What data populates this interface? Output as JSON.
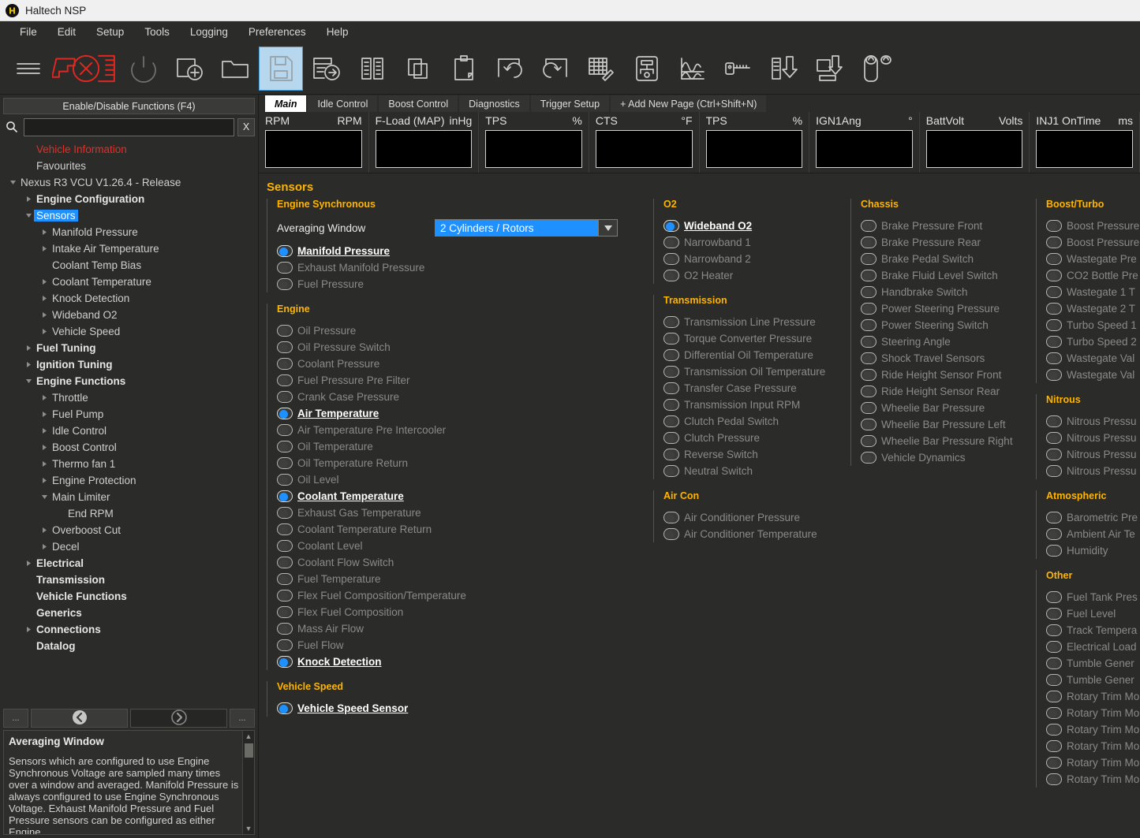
{
  "window": {
    "title": "Haltech NSP",
    "logo_icon": "haltech-logo-icon"
  },
  "menubar": {
    "items": [
      "File",
      "Edit",
      "Setup",
      "Tools",
      "Logging",
      "Preferences",
      "Help"
    ]
  },
  "toolbar": {
    "items": [
      {
        "name": "hamburger-menu-icon",
        "label": "Menu",
        "state": "normal"
      },
      {
        "name": "disconnect-ecu-icon",
        "label": "Disconnect ECU",
        "state": "normal"
      },
      {
        "name": "power-icon",
        "label": "Power",
        "state": "disabled"
      },
      {
        "name": "new-file-icon",
        "label": "New",
        "state": "normal"
      },
      {
        "name": "open-folder-icon",
        "label": "Open",
        "state": "normal"
      },
      {
        "name": "save-icon",
        "label": "Save",
        "state": "selected"
      },
      {
        "name": "save-as-icon",
        "label": "Save As",
        "state": "normal"
      },
      {
        "name": "compare-icon",
        "label": "Compare",
        "state": "normal"
      },
      {
        "name": "copy-icon",
        "label": "Copy",
        "state": "normal"
      },
      {
        "name": "paste-icon",
        "label": "Paste",
        "state": "normal"
      },
      {
        "name": "undo-icon",
        "label": "Undo",
        "state": "normal"
      },
      {
        "name": "redo-icon",
        "label": "Redo",
        "state": "normal"
      },
      {
        "name": "table-edit-icon",
        "label": "Edit Table",
        "state": "normal"
      },
      {
        "name": "wiring-diagram-icon",
        "label": "Wiring",
        "state": "normal"
      },
      {
        "name": "scope-icon",
        "label": "Scope",
        "state": "normal"
      },
      {
        "name": "key-license-icon",
        "label": "License",
        "state": "normal"
      },
      {
        "name": "download-to-ecu-icon",
        "label": "Send to ECU",
        "state": "normal"
      },
      {
        "name": "upload-from-ecu-icon",
        "label": "Get from ECU",
        "state": "normal"
      },
      {
        "name": "fuel-tune-icon",
        "label": "Tune",
        "state": "normal"
      }
    ]
  },
  "sidebar": {
    "functions_button": "Enable/Disable Functions (F4)",
    "search": {
      "value": "",
      "placeholder": "",
      "clear_label": "X",
      "icon": "search-icon"
    },
    "tree": [
      {
        "label": "Vehicle Information",
        "indent": 1,
        "arrow": "none",
        "style": "red"
      },
      {
        "label": "Favourites",
        "indent": 1,
        "arrow": "none",
        "style": "normal"
      },
      {
        "label": "Nexus R3 VCU V1.26.4 - Release",
        "indent": 0,
        "arrow": "down",
        "style": "normal"
      },
      {
        "label": "Engine Configuration",
        "indent": 1,
        "arrow": "right",
        "style": "bold"
      },
      {
        "label": "Sensors",
        "indent": 1,
        "arrow": "down",
        "style": "selected"
      },
      {
        "label": "Manifold Pressure",
        "indent": 2,
        "arrow": "right",
        "style": "normal"
      },
      {
        "label": "Intake Air Temperature",
        "indent": 2,
        "arrow": "right",
        "style": "normal"
      },
      {
        "label": "Coolant Temp Bias",
        "indent": 2,
        "arrow": "none",
        "style": "normal"
      },
      {
        "label": "Coolant Temperature",
        "indent": 2,
        "arrow": "right",
        "style": "normal"
      },
      {
        "label": "Knock Detection",
        "indent": 2,
        "arrow": "right",
        "style": "normal"
      },
      {
        "label": "Wideband O2",
        "indent": 2,
        "arrow": "right",
        "style": "normal"
      },
      {
        "label": "Vehicle Speed",
        "indent": 2,
        "arrow": "right",
        "style": "normal"
      },
      {
        "label": "Fuel Tuning",
        "indent": 1,
        "arrow": "right",
        "style": "bold"
      },
      {
        "label": "Ignition Tuning",
        "indent": 1,
        "arrow": "right",
        "style": "bold"
      },
      {
        "label": "Engine Functions",
        "indent": 1,
        "arrow": "down",
        "style": "bold"
      },
      {
        "label": "Throttle",
        "indent": 2,
        "arrow": "right",
        "style": "normal"
      },
      {
        "label": "Fuel Pump",
        "indent": 2,
        "arrow": "right",
        "style": "normal"
      },
      {
        "label": "Idle Control",
        "indent": 2,
        "arrow": "right",
        "style": "normal"
      },
      {
        "label": "Boost Control",
        "indent": 2,
        "arrow": "right",
        "style": "normal"
      },
      {
        "label": "Thermo fan 1",
        "indent": 2,
        "arrow": "right",
        "style": "normal"
      },
      {
        "label": "Engine Protection",
        "indent": 2,
        "arrow": "right",
        "style": "normal"
      },
      {
        "label": "Main Limiter",
        "indent": 2,
        "arrow": "down",
        "style": "normal"
      },
      {
        "label": "End RPM",
        "indent": 3,
        "arrow": "none",
        "style": "normal"
      },
      {
        "label": "Overboost Cut",
        "indent": 2,
        "arrow": "right",
        "style": "normal"
      },
      {
        "label": "Decel",
        "indent": 2,
        "arrow": "right",
        "style": "normal"
      },
      {
        "label": "Electrical",
        "indent": 1,
        "arrow": "right",
        "style": "bold"
      },
      {
        "label": "Transmission",
        "indent": 1,
        "arrow": "none",
        "style": "bold"
      },
      {
        "label": "Vehicle Functions",
        "indent": 1,
        "arrow": "none",
        "style": "bold"
      },
      {
        "label": "Generics",
        "indent": 1,
        "arrow": "none",
        "style": "bold"
      },
      {
        "label": "Connections",
        "indent": 1,
        "arrow": "right",
        "style": "bold"
      },
      {
        "label": "Datalog",
        "indent": 1,
        "arrow": "none",
        "style": "bold"
      }
    ],
    "nav": {
      "more_left_label": "...",
      "back_icon": "chevron-left-circle-icon",
      "forward_icon": "chevron-right-circle-icon",
      "more_right_label": "..."
    },
    "help": {
      "title": "Averaging Window",
      "text": "Sensors which are configured to use Engine Synchronous Voltage are sampled many times over a window and averaged.\nManifold Pressure is always configured to use Engine Synchronous Voltage.\nExhaust Manifold Pressure and Fuel Pressure sensors can be configured as either Engine"
    }
  },
  "tabs": [
    {
      "label": "Main",
      "active": true
    },
    {
      "label": "Idle Control",
      "active": false
    },
    {
      "label": "Boost Control",
      "active": false
    },
    {
      "label": "Diagnostics",
      "active": false
    },
    {
      "label": "Trigger Setup",
      "active": false
    },
    {
      "label": "+ Add New Page (Ctrl+Shift+N)",
      "active": false
    }
  ],
  "gauges": [
    {
      "name": "RPM",
      "unit": "RPM",
      "value": ""
    },
    {
      "name": "F-Load (MAP)",
      "unit": "inHg",
      "value": ""
    },
    {
      "name": "TPS",
      "unit": "%",
      "value": ""
    },
    {
      "name": "CTS",
      "unit": "°F",
      "value": ""
    },
    {
      "name": "TPS",
      "unit": "%",
      "value": ""
    },
    {
      "name": "IGN1Ang",
      "unit": "°",
      "value": ""
    },
    {
      "name": "BattVolt",
      "unit": "Volts",
      "value": ""
    },
    {
      "name": "INJ1 OnTime",
      "unit": "ms",
      "value": ""
    }
  ],
  "main": {
    "title": "Sensors",
    "averaging": {
      "label": "Averaging Window",
      "value": "2 Cylinders / Rotors",
      "caret_icon": "chevron-down-icon"
    },
    "columns": [
      {
        "groups": [
          {
            "title": "Engine Synchronous",
            "has_averaging": true,
            "options": [
              {
                "label": "Manifold Pressure",
                "on": true
              },
              {
                "label": "Exhaust Manifold Pressure",
                "on": false
              },
              {
                "label": "Fuel Pressure",
                "on": false
              }
            ]
          },
          {
            "title": "Engine",
            "has_averaging": false,
            "options": [
              {
                "label": "Oil Pressure",
                "on": false
              },
              {
                "label": "Oil Pressure Switch",
                "on": false
              },
              {
                "label": "Coolant Pressure",
                "on": false
              },
              {
                "label": "Fuel Pressure Pre Filter",
                "on": false
              },
              {
                "label": "Crank Case Pressure",
                "on": false
              },
              {
                "label": "Air Temperature",
                "on": true
              },
              {
                "label": "Air Temperature Pre Intercooler",
                "on": false
              },
              {
                "label": "Oil Temperature",
                "on": false
              },
              {
                "label": "Oil Temperature Return",
                "on": false
              },
              {
                "label": "Oil Level",
                "on": false
              },
              {
                "label": "Coolant Temperature",
                "on": true
              },
              {
                "label": "Exhaust Gas Temperature",
                "on": false
              },
              {
                "label": "Coolant Temperature Return",
                "on": false
              },
              {
                "label": "Coolant Level",
                "on": false
              },
              {
                "label": "Coolant Flow Switch",
                "on": false
              },
              {
                "label": "Fuel Temperature",
                "on": false
              },
              {
                "label": "Flex Fuel Composition/Temperature",
                "on": false
              },
              {
                "label": "Flex Fuel Composition",
                "on": false
              },
              {
                "label": "Mass Air Flow",
                "on": false
              },
              {
                "label": "Fuel Flow",
                "on": false
              },
              {
                "label": "Knock Detection",
                "on": true
              }
            ]
          },
          {
            "title": "Vehicle Speed",
            "has_averaging": false,
            "options": [
              {
                "label": "Vehicle Speed Sensor",
                "on": true
              }
            ]
          }
        ]
      },
      {
        "groups": [
          {
            "title": "O2",
            "has_averaging": false,
            "options": [
              {
                "label": "Wideband O2",
                "on": true
              },
              {
                "label": "Narrowband 1",
                "on": false
              },
              {
                "label": "Narrowband 2",
                "on": false
              },
              {
                "label": "O2 Heater",
                "on": false
              }
            ]
          },
          {
            "title": "Transmission",
            "has_averaging": false,
            "options": [
              {
                "label": "Transmission Line Pressure",
                "on": false
              },
              {
                "label": "Torque Converter Pressure",
                "on": false
              },
              {
                "label": "Differential Oil Temperature",
                "on": false
              },
              {
                "label": "Transmission Oil Temperature",
                "on": false
              },
              {
                "label": "Transfer Case Pressure",
                "on": false
              },
              {
                "label": "Transmission Input RPM",
                "on": false
              },
              {
                "label": "Clutch Pedal Switch",
                "on": false
              },
              {
                "label": "Clutch Pressure",
                "on": false
              },
              {
                "label": "Reverse Switch",
                "on": false
              },
              {
                "label": "Neutral Switch",
                "on": false
              }
            ]
          },
          {
            "title": "Air Con",
            "has_averaging": false,
            "options": [
              {
                "label": "Air Conditioner Pressure",
                "on": false
              },
              {
                "label": "Air Conditioner Temperature",
                "on": false
              }
            ]
          }
        ]
      },
      {
        "groups": [
          {
            "title": "Chassis",
            "has_averaging": false,
            "options": [
              {
                "label": "Brake Pressure Front",
                "on": false
              },
              {
                "label": "Brake Pressure Rear",
                "on": false
              },
              {
                "label": "Brake Pedal Switch",
                "on": false
              },
              {
                "label": "Brake Fluid Level Switch",
                "on": false
              },
              {
                "label": "Handbrake Switch",
                "on": false
              },
              {
                "label": "Power Steering Pressure",
                "on": false
              },
              {
                "label": "Power Steering Switch",
                "on": false
              },
              {
                "label": "Steering Angle",
                "on": false
              },
              {
                "label": "Shock Travel Sensors",
                "on": false
              },
              {
                "label": "Ride Height Sensor Front",
                "on": false
              },
              {
                "label": "Ride Height Sensor Rear",
                "on": false
              },
              {
                "label": "Wheelie Bar Pressure",
                "on": false
              },
              {
                "label": "Wheelie Bar Pressure Left",
                "on": false
              },
              {
                "label": "Wheelie Bar Pressure Right",
                "on": false
              },
              {
                "label": "Vehicle Dynamics",
                "on": false
              }
            ]
          }
        ]
      },
      {
        "groups": [
          {
            "title": "Boost/Turbo",
            "has_averaging": false,
            "options": [
              {
                "label": "Boost Pressure",
                "on": false
              },
              {
                "label": "Boost Pressure",
                "on": false
              },
              {
                "label": "Wastegate Pre",
                "on": false
              },
              {
                "label": "CO2 Bottle Pre",
                "on": false
              },
              {
                "label": "Wastegate 1 T",
                "on": false
              },
              {
                "label": "Wastegate 2 T",
                "on": false
              },
              {
                "label": "Turbo Speed 1",
                "on": false
              },
              {
                "label": "Turbo Speed 2",
                "on": false
              },
              {
                "label": "Wastegate Val",
                "on": false
              },
              {
                "label": "Wastegate Val",
                "on": false
              }
            ]
          },
          {
            "title": "Nitrous",
            "has_averaging": false,
            "options": [
              {
                "label": "Nitrous Pressu",
                "on": false
              },
              {
                "label": "Nitrous Pressu",
                "on": false
              },
              {
                "label": "Nitrous Pressu",
                "on": false
              },
              {
                "label": "Nitrous Pressu",
                "on": false
              }
            ]
          },
          {
            "title": "Atmospheric",
            "has_averaging": false,
            "options": [
              {
                "label": "Barometric Pre",
                "on": false
              },
              {
                "label": "Ambient Air Te",
                "on": false
              },
              {
                "label": "Humidity",
                "on": false
              }
            ]
          },
          {
            "title": "Other",
            "has_averaging": false,
            "options": [
              {
                "label": "Fuel Tank Pres",
                "on": false
              },
              {
                "label": "Fuel Level",
                "on": false
              },
              {
                "label": "Track Tempera",
                "on": false
              },
              {
                "label": "Electrical Load",
                "on": false
              },
              {
                "label": "Tumble Gener",
                "on": false
              },
              {
                "label": "Tumble Gener",
                "on": false
              },
              {
                "label": "Rotary Trim Mo",
                "on": false
              },
              {
                "label": "Rotary Trim Mo",
                "on": false
              },
              {
                "label": "Rotary Trim Mo",
                "on": false
              },
              {
                "label": "Rotary Trim Mo",
                "on": false
              },
              {
                "label": "Rotary Trim Mo",
                "on": false
              },
              {
                "label": "Rotary Trim Mo",
                "on": false
              }
            ]
          }
        ]
      }
    ]
  },
  "colors": {
    "accent_orange": "#ffb400",
    "accent_blue": "#1e90ff",
    "alert_red": "#e03028",
    "background": "#2b2b29"
  }
}
